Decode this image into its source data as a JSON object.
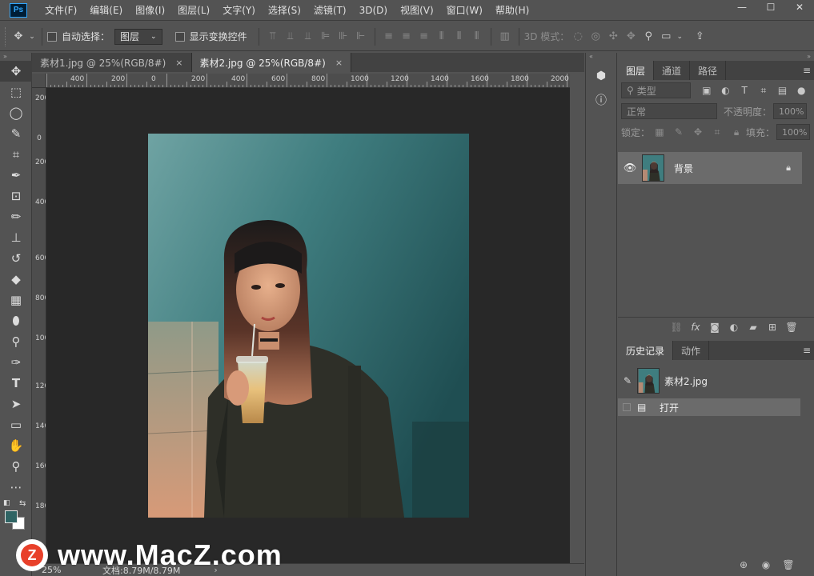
{
  "app": {
    "logo_text": "Ps"
  },
  "menu": [
    "文件(F)",
    "编辑(E)",
    "图像(I)",
    "图层(L)",
    "文字(Y)",
    "选择(S)",
    "滤镜(T)",
    "3D(D)",
    "视图(V)",
    "窗口(W)",
    "帮助(H)"
  ],
  "window_controls": {
    "minimize": "—",
    "maximize": "☐",
    "close": "✕"
  },
  "options_bar": {
    "auto_select_label": "自动选择：",
    "auto_select_value": "图层",
    "show_transform_label": "显示变换控件",
    "mode_3d_label": "3D 模式："
  },
  "tabs": [
    {
      "label": "素材1.jpg @ 25%(RGB/8#)",
      "close": "×"
    },
    {
      "label": "素材2.jpg @ 25%(RGB/8#)",
      "close": "×"
    }
  ],
  "ruler": {
    "h_labels": [
      "400",
      "200",
      "0",
      "200",
      "400",
      "600",
      "800",
      "1000",
      "1200",
      "1400",
      "1600",
      "1800",
      "2000"
    ],
    "v_labels": [
      "200",
      "0",
      "200",
      "400",
      "600",
      "800",
      "1000",
      "1200",
      "1400",
      "1600",
      "1800"
    ]
  },
  "status": {
    "zoom": "25%",
    "doc_size": "文档:8.79M/8.79M",
    "arrow": "›"
  },
  "watermark": {
    "logo_letter": "Z",
    "text": "www.MacZ.com"
  },
  "layers_panel": {
    "tabs": [
      "图层",
      "通道",
      "路径"
    ],
    "filter_label": "类型",
    "blend_mode": "正常",
    "opacity_label": "不透明度：",
    "opacity_value": "100%",
    "lock_label": "锁定：",
    "fill_label": "填充：",
    "fill_value": "100%",
    "layer_name": "背景"
  },
  "history_panel": {
    "tabs": [
      "历史记录",
      "动作"
    ],
    "snapshot": "素材2.jpg",
    "steps": [
      "打开"
    ]
  }
}
